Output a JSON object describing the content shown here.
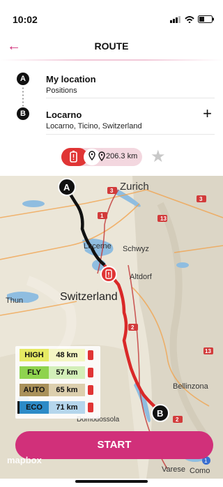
{
  "status": {
    "time": "10:02"
  },
  "header": {
    "title": "ROUTE"
  },
  "route": {
    "origin": {
      "badge": "A",
      "name": "My location",
      "sub": "Positions"
    },
    "destination": {
      "badge": "B",
      "name": "Locarno",
      "sub": "Locarno, Ticino, Switzerland"
    }
  },
  "summary": {
    "distance": "206.3 km"
  },
  "map": {
    "labels": [
      "Zurich",
      "Lucerne",
      "Schwyz",
      "Altdorf",
      "Switzerland",
      "Thun",
      "Bellinzona",
      "Varese",
      "Como",
      "Domodossola"
    ],
    "attribution": "mapbox",
    "route_colors": {
      "normal": "#111111",
      "warning": "#d92828"
    }
  },
  "legend": [
    {
      "name": "HIGH",
      "value": "48 km",
      "color": "#e6ea63"
    },
    {
      "name": "FLY",
      "value": "57 km",
      "color": "#8fd34e"
    },
    {
      "name": "AUTO",
      "value": "65 km",
      "color": "#a9915a"
    },
    {
      "name": "ECO",
      "value": "71 km",
      "color": "#2d8bc7"
    }
  ],
  "actions": {
    "start": "START"
  },
  "colors": {
    "accent": "#d1307a",
    "danger": "#e03535"
  }
}
